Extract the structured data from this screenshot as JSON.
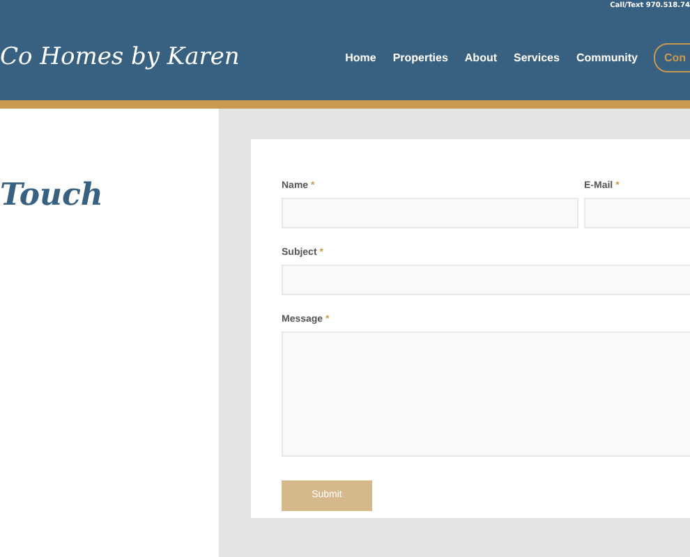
{
  "header": {
    "contact_line": "Call/Text 970.518.74",
    "logo": "Co Homes by Karen",
    "nav": [
      {
        "label": "Home"
      },
      {
        "label": "Properties"
      },
      {
        "label": "About"
      },
      {
        "label": "Services"
      },
      {
        "label": "Community"
      }
    ],
    "cta": "Con"
  },
  "heading": "Touch",
  "form": {
    "rows": [
      {
        "fields": [
          {
            "label": "Name",
            "mark": "*",
            "kind": "input"
          },
          {
            "label": "E-Mail",
            "mark": "*",
            "kind": "input"
          }
        ]
      },
      {
        "fields": [
          {
            "label": "Subject",
            "mark": "*",
            "kind": "input"
          }
        ]
      },
      {
        "fields": [
          {
            "label": "Message",
            "mark": "*",
            "kind": "textarea"
          }
        ]
      }
    ],
    "submit": "Submit"
  }
}
